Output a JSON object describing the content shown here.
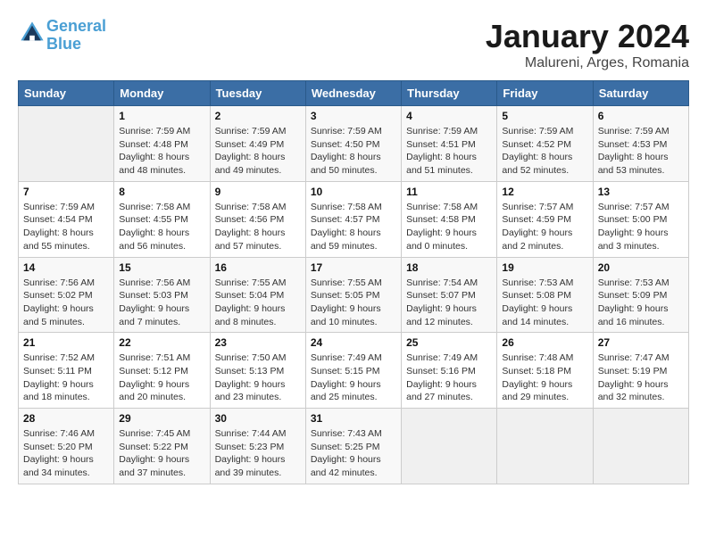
{
  "header": {
    "logo_line1": "General",
    "logo_line2": "Blue",
    "title": "January 2024",
    "subtitle": "Malureni, Arges, Romania"
  },
  "weekdays": [
    "Sunday",
    "Monday",
    "Tuesday",
    "Wednesday",
    "Thursday",
    "Friday",
    "Saturday"
  ],
  "weeks": [
    [
      {
        "day": "",
        "details": ""
      },
      {
        "day": "1",
        "details": "Sunrise: 7:59 AM\nSunset: 4:48 PM\nDaylight: 8 hours\nand 48 minutes."
      },
      {
        "day": "2",
        "details": "Sunrise: 7:59 AM\nSunset: 4:49 PM\nDaylight: 8 hours\nand 49 minutes."
      },
      {
        "day": "3",
        "details": "Sunrise: 7:59 AM\nSunset: 4:50 PM\nDaylight: 8 hours\nand 50 minutes."
      },
      {
        "day": "4",
        "details": "Sunrise: 7:59 AM\nSunset: 4:51 PM\nDaylight: 8 hours\nand 51 minutes."
      },
      {
        "day": "5",
        "details": "Sunrise: 7:59 AM\nSunset: 4:52 PM\nDaylight: 8 hours\nand 52 minutes."
      },
      {
        "day": "6",
        "details": "Sunrise: 7:59 AM\nSunset: 4:53 PM\nDaylight: 8 hours\nand 53 minutes."
      }
    ],
    [
      {
        "day": "7",
        "details": "Sunrise: 7:59 AM\nSunset: 4:54 PM\nDaylight: 8 hours\nand 55 minutes."
      },
      {
        "day": "8",
        "details": "Sunrise: 7:58 AM\nSunset: 4:55 PM\nDaylight: 8 hours\nand 56 minutes."
      },
      {
        "day": "9",
        "details": "Sunrise: 7:58 AM\nSunset: 4:56 PM\nDaylight: 8 hours\nand 57 minutes."
      },
      {
        "day": "10",
        "details": "Sunrise: 7:58 AM\nSunset: 4:57 PM\nDaylight: 8 hours\nand 59 minutes."
      },
      {
        "day": "11",
        "details": "Sunrise: 7:58 AM\nSunset: 4:58 PM\nDaylight: 9 hours\nand 0 minutes."
      },
      {
        "day": "12",
        "details": "Sunrise: 7:57 AM\nSunset: 4:59 PM\nDaylight: 9 hours\nand 2 minutes."
      },
      {
        "day": "13",
        "details": "Sunrise: 7:57 AM\nSunset: 5:00 PM\nDaylight: 9 hours\nand 3 minutes."
      }
    ],
    [
      {
        "day": "14",
        "details": "Sunrise: 7:56 AM\nSunset: 5:02 PM\nDaylight: 9 hours\nand 5 minutes."
      },
      {
        "day": "15",
        "details": "Sunrise: 7:56 AM\nSunset: 5:03 PM\nDaylight: 9 hours\nand 7 minutes."
      },
      {
        "day": "16",
        "details": "Sunrise: 7:55 AM\nSunset: 5:04 PM\nDaylight: 9 hours\nand 8 minutes."
      },
      {
        "day": "17",
        "details": "Sunrise: 7:55 AM\nSunset: 5:05 PM\nDaylight: 9 hours\nand 10 minutes."
      },
      {
        "day": "18",
        "details": "Sunrise: 7:54 AM\nSunset: 5:07 PM\nDaylight: 9 hours\nand 12 minutes."
      },
      {
        "day": "19",
        "details": "Sunrise: 7:53 AM\nSunset: 5:08 PM\nDaylight: 9 hours\nand 14 minutes."
      },
      {
        "day": "20",
        "details": "Sunrise: 7:53 AM\nSunset: 5:09 PM\nDaylight: 9 hours\nand 16 minutes."
      }
    ],
    [
      {
        "day": "21",
        "details": "Sunrise: 7:52 AM\nSunset: 5:11 PM\nDaylight: 9 hours\nand 18 minutes."
      },
      {
        "day": "22",
        "details": "Sunrise: 7:51 AM\nSunset: 5:12 PM\nDaylight: 9 hours\nand 20 minutes."
      },
      {
        "day": "23",
        "details": "Sunrise: 7:50 AM\nSunset: 5:13 PM\nDaylight: 9 hours\nand 23 minutes."
      },
      {
        "day": "24",
        "details": "Sunrise: 7:49 AM\nSunset: 5:15 PM\nDaylight: 9 hours\nand 25 minutes."
      },
      {
        "day": "25",
        "details": "Sunrise: 7:49 AM\nSunset: 5:16 PM\nDaylight: 9 hours\nand 27 minutes."
      },
      {
        "day": "26",
        "details": "Sunrise: 7:48 AM\nSunset: 5:18 PM\nDaylight: 9 hours\nand 29 minutes."
      },
      {
        "day": "27",
        "details": "Sunrise: 7:47 AM\nSunset: 5:19 PM\nDaylight: 9 hours\nand 32 minutes."
      }
    ],
    [
      {
        "day": "28",
        "details": "Sunrise: 7:46 AM\nSunset: 5:20 PM\nDaylight: 9 hours\nand 34 minutes."
      },
      {
        "day": "29",
        "details": "Sunrise: 7:45 AM\nSunset: 5:22 PM\nDaylight: 9 hours\nand 37 minutes."
      },
      {
        "day": "30",
        "details": "Sunrise: 7:44 AM\nSunset: 5:23 PM\nDaylight: 9 hours\nand 39 minutes."
      },
      {
        "day": "31",
        "details": "Sunrise: 7:43 AM\nSunset: 5:25 PM\nDaylight: 9 hours\nand 42 minutes."
      },
      {
        "day": "",
        "details": ""
      },
      {
        "day": "",
        "details": ""
      },
      {
        "day": "",
        "details": ""
      }
    ]
  ]
}
